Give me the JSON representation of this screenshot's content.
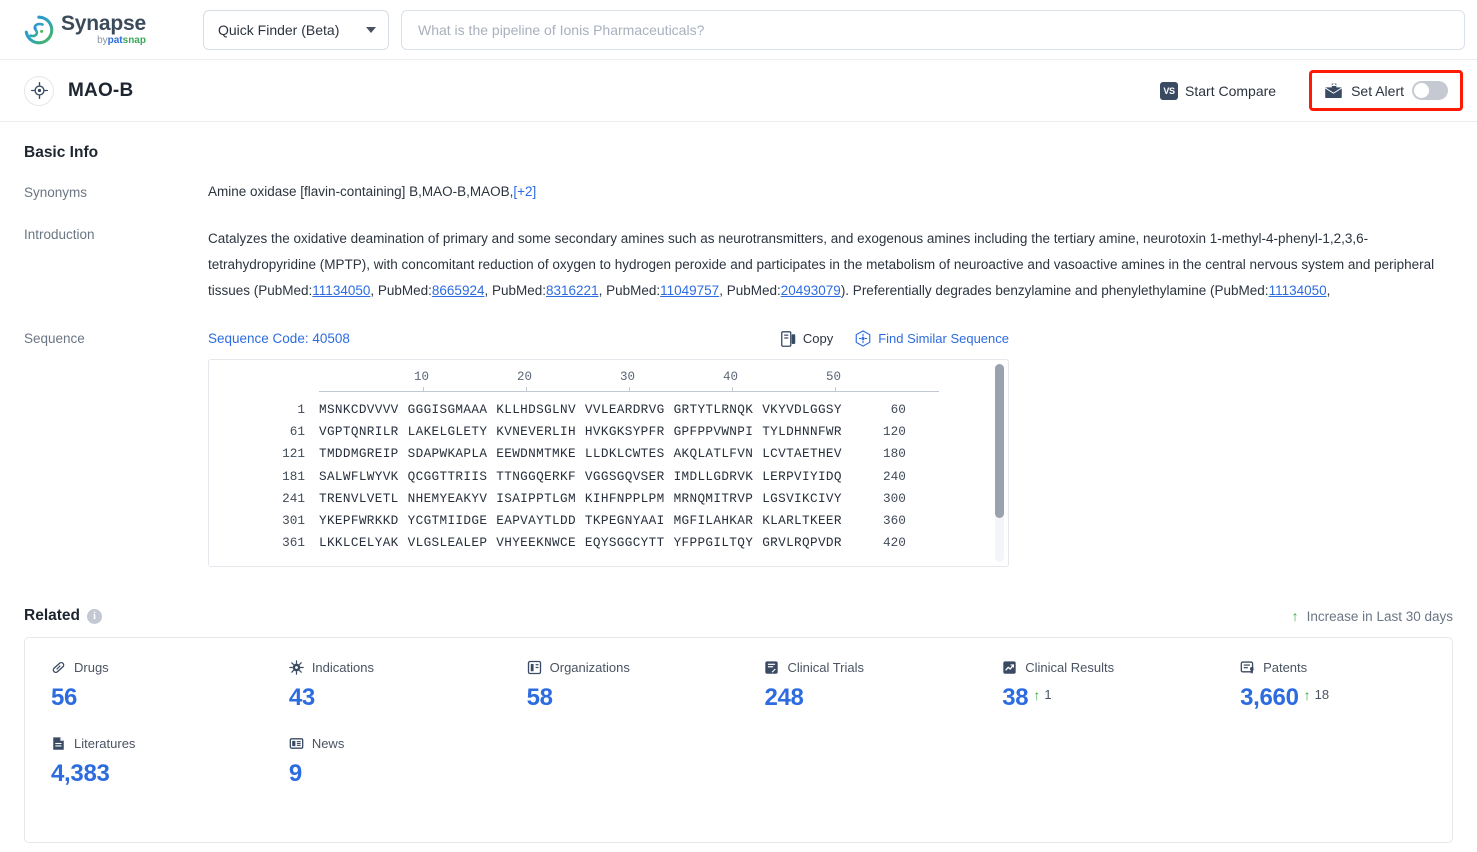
{
  "topbar": {
    "logo_title": "Synapse",
    "logo_by": "by",
    "logo_pat": "pat",
    "logo_snap": "snap",
    "finder_label": "Quick Finder (Beta)",
    "search_placeholder": "What is the pipeline of Ionis Pharmaceuticals?",
    "search_value": ""
  },
  "entity": {
    "title": "MAO-B",
    "start_compare_label": "Start Compare",
    "vs_badge": "VS",
    "set_alert_label": "Set Alert",
    "alert_enabled": false,
    "highlight_color": "#ff1a05"
  },
  "basic_info": {
    "section_title": "Basic Info",
    "synonyms_label": "Synonyms",
    "synonyms_value": "Amine oxidase [flavin-containing] B,MAO-B,MAOB,",
    "synonyms_more": "[+2]",
    "introduction_label": "Introduction",
    "introduction_parts": {
      "p1": "Catalyzes the oxidative deamination of primary and some secondary amines such as neurotransmitters, and exogenous amines including the tertiary amine, neurotoxin 1-methyl-4-phenyl-1,2,3,6-tetrahydropyridine (MPTP), with concomitant reduction of oxygen to hydrogen peroxide and participates in the metabolism of neuroactive and vasoactive amines in the central nervous system and peripheral tissues (PubMed:",
      "ref1": "11134050",
      "p2": ", PubMed:",
      "ref2": "8665924",
      "p3": ", PubMed:",
      "ref3": "8316221",
      "p4": ", PubMed:",
      "ref4": "11049757",
      "p5": ", PubMed:",
      "ref5": "20493079",
      "p6": "). Preferentially degrades benzylamine and phenylethylamine (PubMed:",
      "ref6": "11134050",
      "p7": ","
    }
  },
  "sequence": {
    "label": "Sequence",
    "code_label": "Sequence Code: 40508",
    "copy_label": "Copy",
    "find_similar_label": "Find Similar Sequence",
    "ruler_ticks": [
      "10",
      "20",
      "30",
      "40",
      "50"
    ],
    "rows": [
      {
        "start": "1",
        "blocks": [
          "MSNKCDVVVV",
          "GGGISGMAAA",
          "KLLHDSGLNV",
          "VVLEARDRVG",
          "GRTYTLRNQK",
          "VKYVDLGGSY"
        ],
        "end": "60"
      },
      {
        "start": "61",
        "blocks": [
          "VGPTQNRILR",
          "LAKELGLETY",
          "KVNEVERLIH",
          "HVKGKSYPFR",
          "GPFPPVWNPI",
          "TYLDHNNFWR"
        ],
        "end": "120"
      },
      {
        "start": "121",
        "blocks": [
          "TMDDMGREIP",
          "SDAPWKAPLA",
          "EEWDNMTMKE",
          "LLDKLCWTES",
          "AKQLATLFVN",
          "LCVTAETHEV"
        ],
        "end": "180"
      },
      {
        "start": "181",
        "blocks": [
          "SALWFLWYVK",
          "QCGGTTRIIS",
          "TTNGGQERKF",
          "VGGSGQVSER",
          "IMDLLGDRVK",
          "LERPVIYIDQ"
        ],
        "end": "240"
      },
      {
        "start": "241",
        "blocks": [
          "TRENVLVETL",
          "NHEMYEAKYV",
          "ISAIPPTLGM",
          "KIHFNPPLPM",
          "MRNQMITRVP",
          "LGSVIKCIVY"
        ],
        "end": "300"
      },
      {
        "start": "301",
        "blocks": [
          "YKEPFWRKKD",
          "YCGTMIIDGE",
          "EAPVAYTLDD",
          "TKPEGNYAAI",
          "MGFILAHKAR",
          "KLARLTKEER"
        ],
        "end": "360"
      },
      {
        "start": "361",
        "blocks": [
          "LKKLCELYAK",
          "VLGSLEALEP",
          "VHYEEKNWCE",
          "EQYSGGCYTT",
          "YFPPGILTQY",
          "GRVLRQPVDR"
        ],
        "end": "420"
      }
    ]
  },
  "related": {
    "title": "Related",
    "increase_note": "Increase in Last 30 days",
    "accent_color": "#2d6cdf",
    "increase_color": "#39a845",
    "stats": [
      {
        "icon": "pill-icon",
        "label": "Drugs",
        "value": "56",
        "delta": ""
      },
      {
        "icon": "virus-icon",
        "label": "Indications",
        "value": "43",
        "delta": ""
      },
      {
        "icon": "building-icon",
        "label": "Organizations",
        "value": "58",
        "delta": ""
      },
      {
        "icon": "clinical-trial-icon",
        "label": "Clinical Trials",
        "value": "248",
        "delta": ""
      },
      {
        "icon": "clinical-result-icon",
        "label": "Clinical Results",
        "value": "38",
        "delta": "1"
      },
      {
        "icon": "patent-icon",
        "label": "Patents",
        "value": "3,660",
        "delta": "18"
      },
      {
        "icon": "literature-icon",
        "label": "Literatures",
        "value": "4,383",
        "delta": ""
      },
      {
        "icon": "news-icon",
        "label": "News",
        "value": "9",
        "delta": ""
      }
    ]
  }
}
